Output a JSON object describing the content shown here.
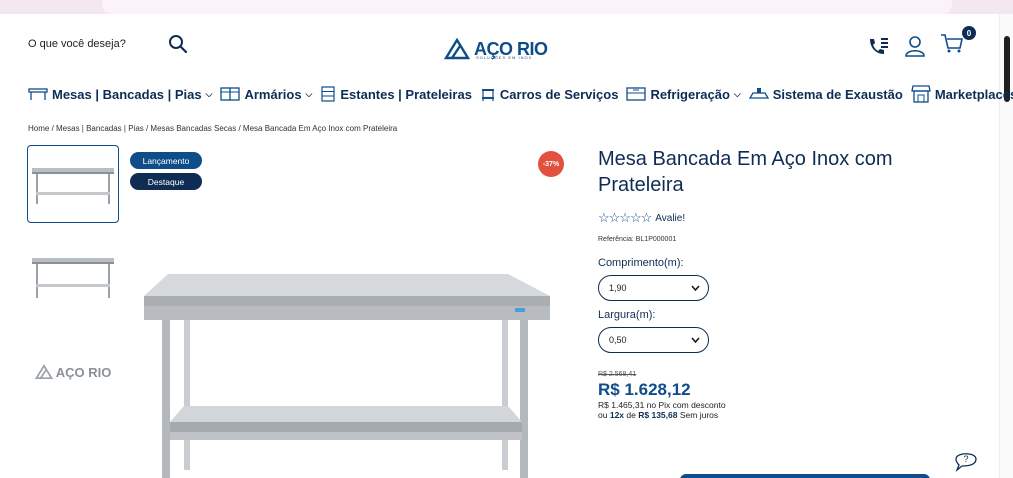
{
  "header": {
    "search_placeholder": "O que você deseja?",
    "logo_text": "AÇO RIO",
    "logo_subtext": "SOLUÇÕES EM INOX",
    "cart_count": "0"
  },
  "nav": {
    "items": [
      {
        "label": "Mesas | Bancadas | Pias",
        "icon": "table-icon",
        "has_dropdown": true
      },
      {
        "label": "Armários",
        "icon": "cabinet-icon",
        "has_dropdown": true
      },
      {
        "label": "Estantes | Prateleiras",
        "icon": "shelf-icon",
        "has_dropdown": false
      },
      {
        "label": "Carros de Serviços",
        "icon": "cart-icon",
        "has_dropdown": false
      },
      {
        "label": "Refrigeração",
        "icon": "fridge-icon",
        "has_dropdown": true
      },
      {
        "label": "Sistema de Exaustão",
        "icon": "hood-icon",
        "has_dropdown": false
      },
      {
        "label": "Marketplaces",
        "icon": "store-icon",
        "has_dropdown": false
      }
    ]
  },
  "breadcrumb": "Home / Mesas | Bancadas | Pias / Mesas Bancadas Secas / Mesa Bancada Em Aço Inox com Prateleira",
  "gallery": {
    "badges": [
      "Lançamento",
      "Destaque"
    ],
    "discount": "-37%",
    "thumb_logo_text": "AÇO RIO"
  },
  "product": {
    "title": "Mesa Bancada Em Aço Inox com Prateleira",
    "rating_stars": "☆☆☆☆☆",
    "rating_label": "Avalie!",
    "reference": "Referência: BL1P000001",
    "length_label": "Comprimento(m):",
    "length_value": "1,90",
    "width_label": "Largura(m):",
    "width_value": "0,50",
    "old_price": "R$ 2.568,41",
    "price": "R$ 1.628,12",
    "pix_text": "R$ 1.465,31 no Pix com desconto",
    "install_prefix": "ou",
    "install_count": "12x",
    "install_mid": "de",
    "install_value": "R$ 135,68",
    "install_suffix": "Sem juros"
  },
  "colors": {
    "primary": "#0f4c8a",
    "dark": "#0f2d54",
    "discount": "#e2513e"
  }
}
